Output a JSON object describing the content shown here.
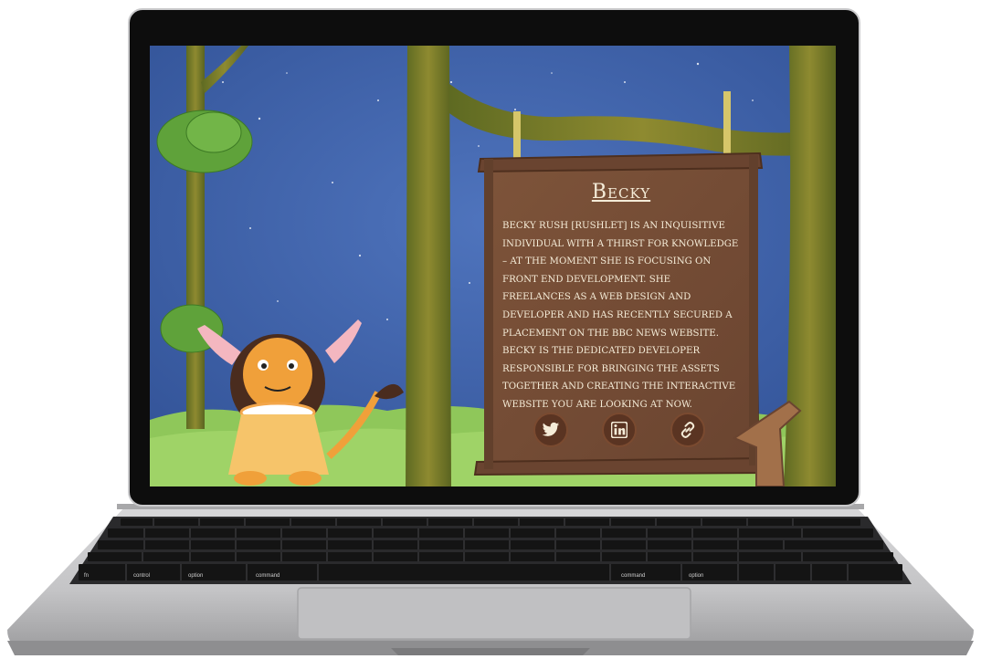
{
  "profile": {
    "name": "Becky",
    "bio_paragraph_1": "Becky Rush [Rushlet] is an inquisitive individual with a thirst for knowledge – at the moment she is focusing on front end development. She freelances as a web design and developer and has recently secured a placement on the BBC News website.",
    "bio_paragraph_2": "Becky is the dedicated developer responsible for bringing the assets together and creating the interactive website you are looking at now."
  },
  "social": [
    {
      "icon": "twitter-icon"
    },
    {
      "icon": "linkedin-icon"
    },
    {
      "icon": "link-icon"
    }
  ],
  "keyboard": {
    "fn": "fn",
    "control": "control",
    "option_left": "option",
    "command_left": "command",
    "command_right": "command",
    "option_right": "option"
  },
  "colors": {
    "sky": "#3a5ea7",
    "tree_bark": "#8a8a2c",
    "wood_panel": "#7a4f36",
    "grass": "#8fc75a",
    "panel_text": "#f5ecd8"
  }
}
